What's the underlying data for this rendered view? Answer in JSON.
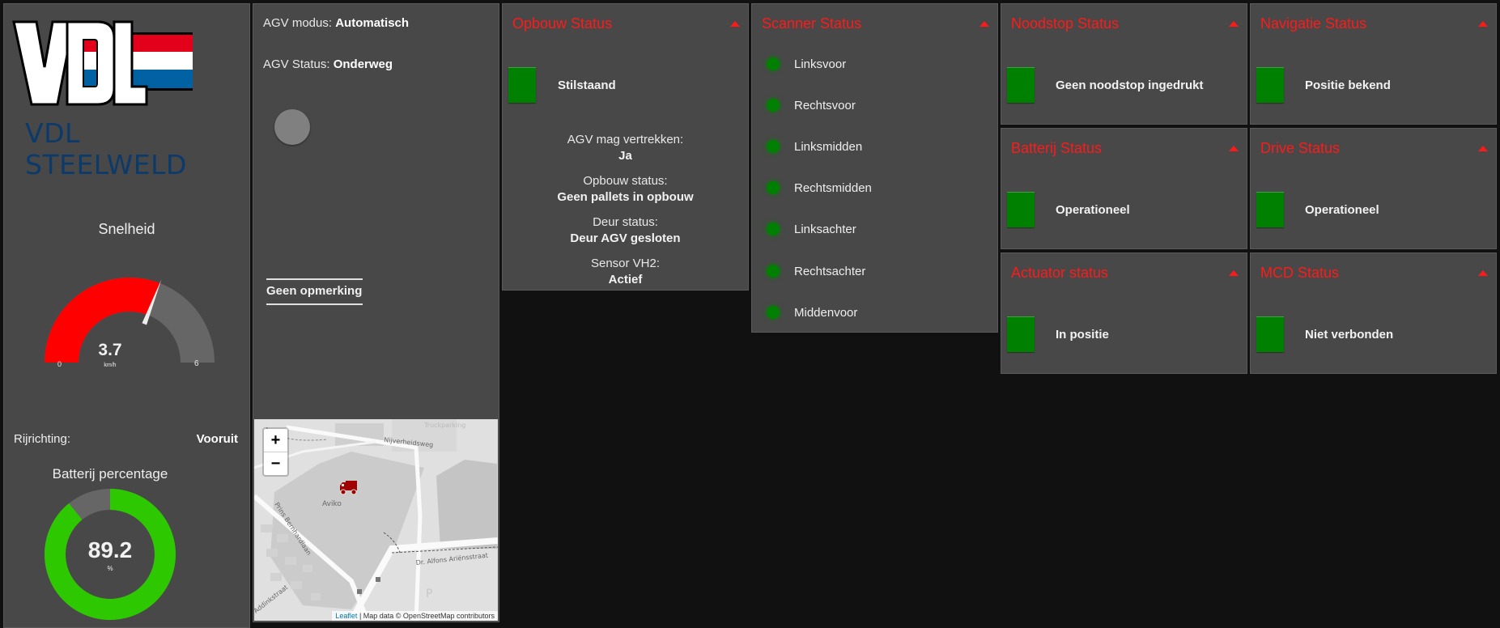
{
  "brand": {
    "logo_text": "VDL",
    "company_name": "VDL STEELWELD",
    "colors": {
      "red": "#e2001a",
      "white": "#ffffff",
      "blue": "#0062a3",
      "company_text": "#0b3a6b"
    }
  },
  "speed": {
    "title": "Snelheid",
    "value": 3.7,
    "value_label": "3.7",
    "unit": "km/h",
    "min": 0,
    "max": 6,
    "min_label": "0",
    "max_label": "6",
    "fill_color": "#ff0000",
    "track_color": "#666666"
  },
  "direction": {
    "label": "Rijrichting:",
    "value": "Vooruit"
  },
  "battery": {
    "title": "Batterij percentage",
    "value": 89.2,
    "value_label": "89.2",
    "unit": "%",
    "fill_color": "#2ec800",
    "track_color": "#666666"
  },
  "agv": {
    "mode_label": "AGV modus:",
    "mode_value": "Automatisch",
    "status_label": "AGV Status:",
    "status_value": "Onderweg",
    "remark": "Geen opmerking"
  },
  "map": {
    "zoom_in": "+",
    "zoom_out": "−",
    "labels": [
      "Truckparking",
      "Nijverheidsweg",
      "Aviko",
      "Prins Bernhardlaan",
      "Dr. Alfons Ariënsstraat",
      "Addinkstraat",
      "P"
    ],
    "attribution_link": "Leaflet",
    "attribution_text": "| Map data © OpenStreetMap contributors",
    "marker_color": "#a00000"
  },
  "opbouw": {
    "title": "Opbouw Status",
    "state": "Stilstaand",
    "state_color": "#008000",
    "items": [
      {
        "label": "AGV mag vertrekken:",
        "value": "Ja"
      },
      {
        "label": "Opbouw status:",
        "value": "Geen pallets in opbouw"
      },
      {
        "label": "Deur status:",
        "value": "Deur AGV gesloten"
      },
      {
        "label": "Sensor VH2:",
        "value": "Actief"
      }
    ]
  },
  "scanner": {
    "title": "Scanner Status",
    "items": [
      {
        "label": "Linksvoor",
        "color": "#008000"
      },
      {
        "label": "Rechtsvoor",
        "color": "#008000"
      },
      {
        "label": "Linksmidden",
        "color": "#008000"
      },
      {
        "label": "Rechtsmidden",
        "color": "#008000"
      },
      {
        "label": "Linksachter",
        "color": "#008000"
      },
      {
        "label": "Rechtsachter",
        "color": "#008000"
      },
      {
        "label": "Middenvoor",
        "color": "#008000"
      }
    ]
  },
  "status_panels": {
    "noodstop": {
      "title": "Noodstop Status",
      "value": "Geen noodstop ingedrukt",
      "color": "#008000"
    },
    "navigatie": {
      "title": "Navigatie Status",
      "value": "Positie bekend",
      "color": "#008000"
    },
    "batterij": {
      "title": "Batterij Status",
      "value": "Operationeel",
      "color": "#008000"
    },
    "drive": {
      "title": "Drive Status",
      "value": "Operationeel",
      "color": "#008000"
    },
    "actuator": {
      "title": "Actuator status",
      "value": "In positie",
      "color": "#008000"
    },
    "mcd": {
      "title": "MCD Status",
      "value": "Niet verbonden",
      "color": "#008000"
    }
  },
  "theme": {
    "title_color": "#ff1a1a",
    "panel_bg": "#484848",
    "page_bg": "#111111"
  }
}
